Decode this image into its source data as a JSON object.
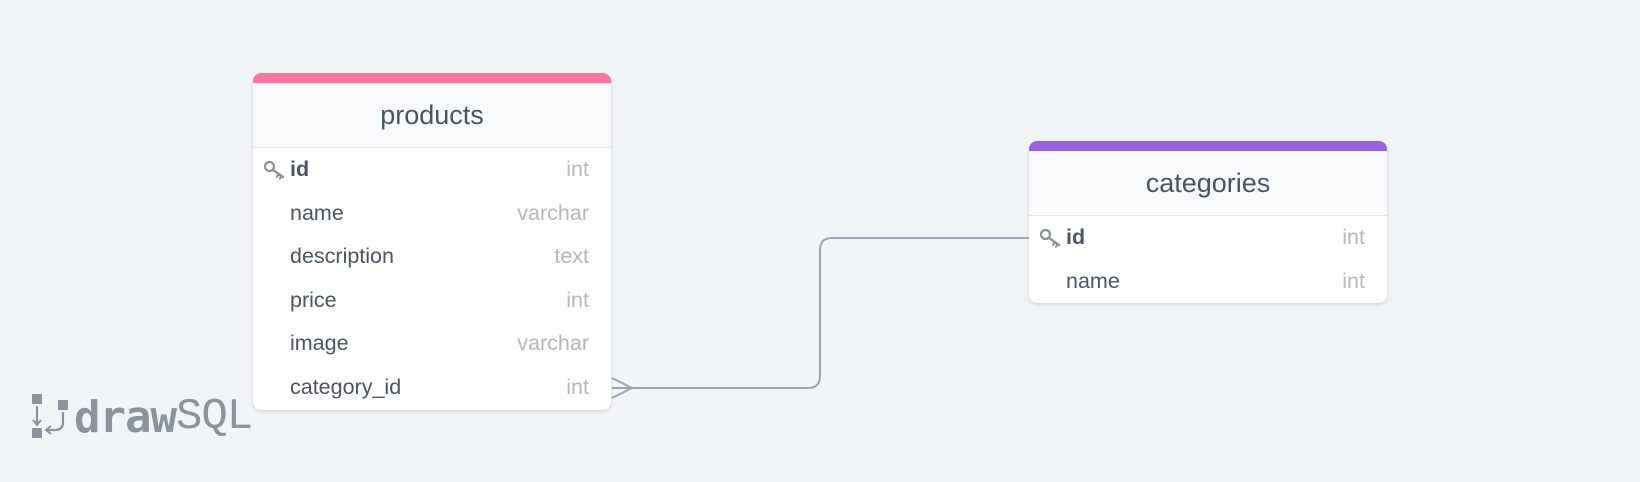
{
  "diagram": {
    "tables": [
      {
        "name": "products",
        "accent": "#f7759e",
        "columns": [
          {
            "name": "id",
            "type": "int",
            "primary_key": true
          },
          {
            "name": "name",
            "type": "varchar"
          },
          {
            "name": "description",
            "type": "text"
          },
          {
            "name": "price",
            "type": "int"
          },
          {
            "name": "image",
            "type": "varchar"
          },
          {
            "name": "category_id",
            "type": "int"
          }
        ]
      },
      {
        "name": "categories",
        "accent": "#9a62de",
        "columns": [
          {
            "name": "id",
            "type": "int",
            "primary_key": true
          },
          {
            "name": "name",
            "type": "int"
          }
        ]
      }
    ],
    "relations": [
      {
        "from": "products.category_id",
        "to": "categories.id",
        "cardinality": "many-to-one"
      }
    ]
  },
  "branding": {
    "logo_bold": "draw",
    "logo_light": "SQL"
  },
  "colors": {
    "background": "#f1f5f8",
    "connector": "#9aa7b6",
    "icon": "#8a929c"
  }
}
